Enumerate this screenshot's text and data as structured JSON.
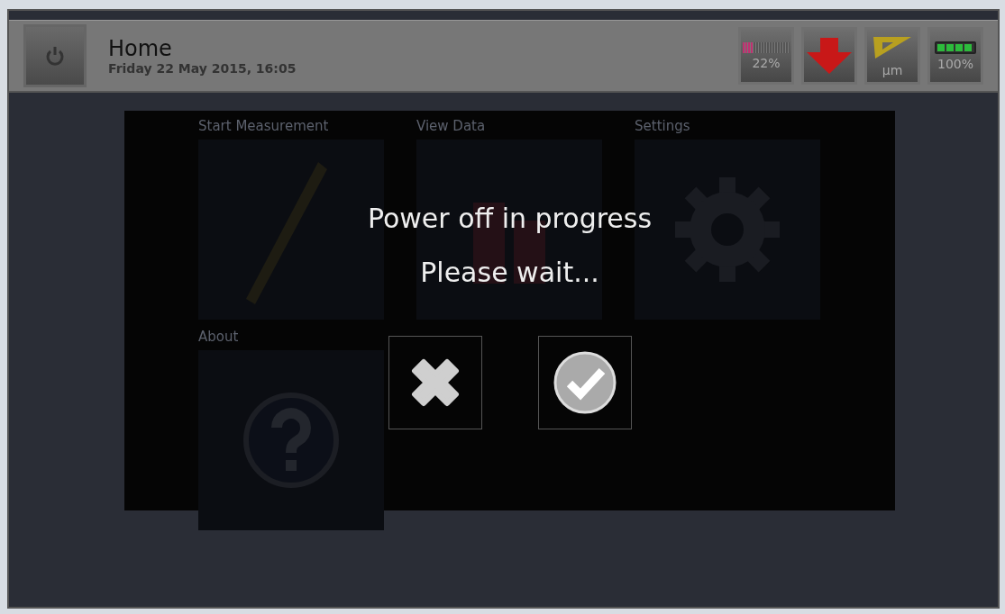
{
  "header": {
    "title": "Home",
    "subtitle": "Friday 22 May 2015, 16:05"
  },
  "status": [
    {
      "kind": "storage",
      "reading": "22%",
      "level": 0.22
    },
    {
      "kind": "arrow"
    },
    {
      "kind": "ruler",
      "reading": "µm"
    },
    {
      "kind": "battery",
      "reading": "100%",
      "level": 1.0
    }
  ],
  "tiles": [
    {
      "kind": "measure",
      "label": "Start Measurement"
    },
    {
      "kind": "data",
      "label": "View Data"
    },
    {
      "kind": "settings",
      "label": "Settings"
    },
    {
      "kind": "about",
      "label": "About"
    }
  ],
  "dialog": {
    "lines": [
      "Power off in progress",
      "Please wait..."
    ],
    "buttons": [
      {
        "kind": "cancel"
      },
      {
        "kind": "confirm"
      }
    ]
  }
}
